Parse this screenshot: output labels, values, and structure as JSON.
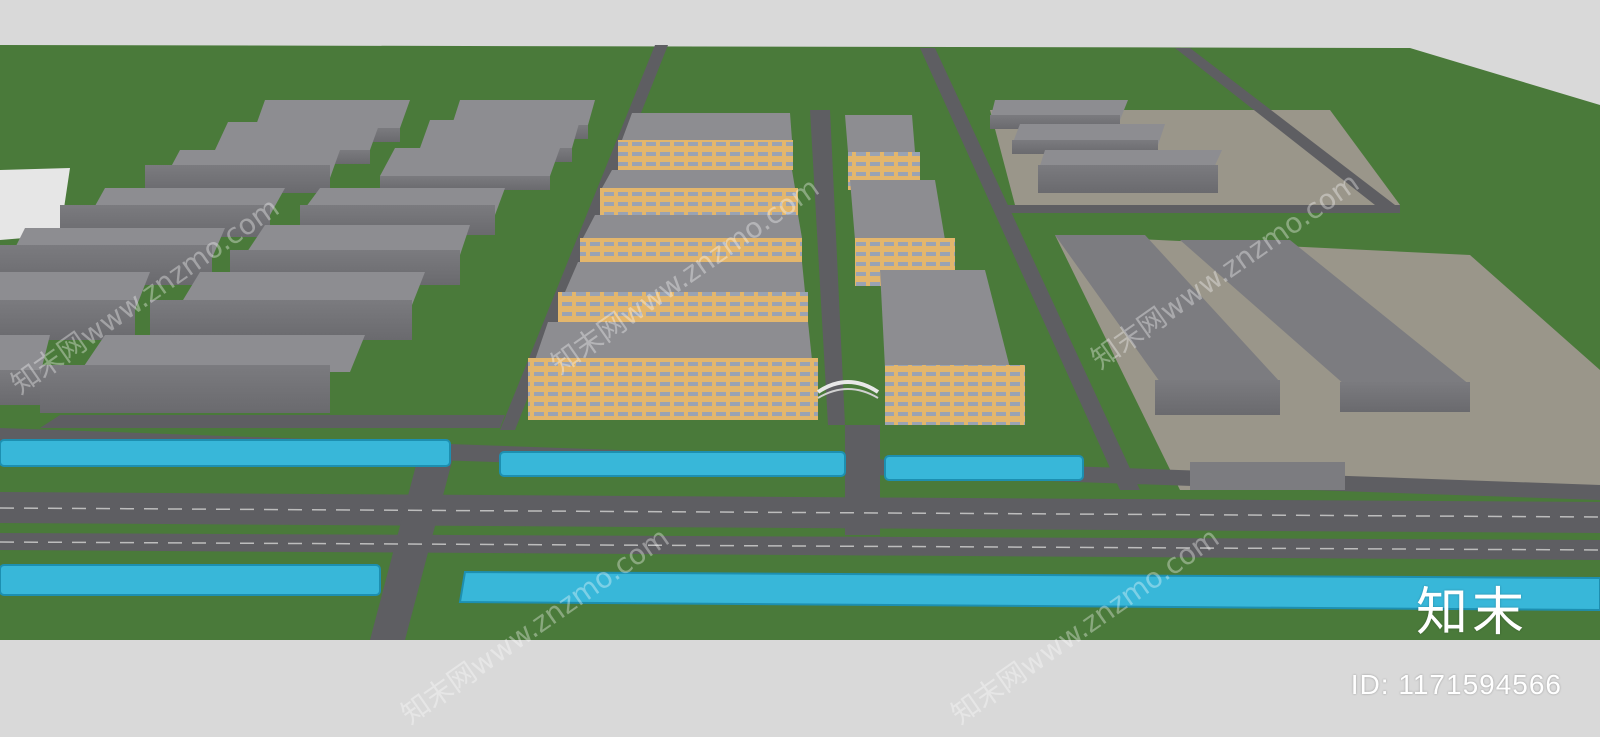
{
  "watermark": {
    "brand": "知末",
    "id_label": "ID: 1171594566",
    "site_text": "知末网www.znzmo.com"
  },
  "colors": {
    "background": "#d9d9d9",
    "grass": "#4a7a3a",
    "road": "#5e5e62",
    "water": "#38b7d9",
    "roof": "#8d8d91",
    "facade": "#e3b66c",
    "lot": "#9a968a"
  }
}
